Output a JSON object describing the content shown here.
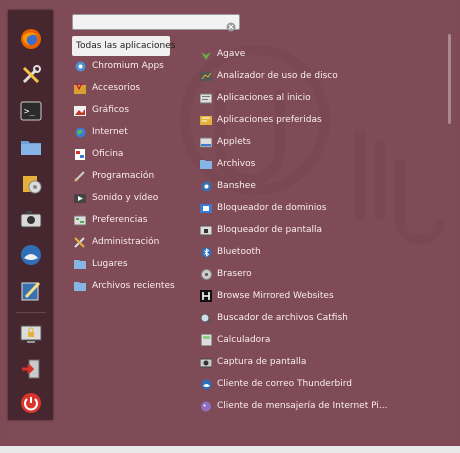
{
  "search": {
    "value": "",
    "placeholder": ""
  },
  "favorites": [
    {
      "icon": "firefox-icon"
    },
    {
      "icon": "settings-tools-icon"
    },
    {
      "icon": "terminal-icon"
    },
    {
      "icon": "folder-icon"
    },
    {
      "icon": "software-package-icon"
    },
    {
      "icon": "camera-icon"
    },
    {
      "icon": "thunderbird-icon"
    },
    {
      "icon": "text-editor-icon"
    },
    {
      "icon": "lock-screen-icon"
    },
    {
      "icon": "logout-icon"
    },
    {
      "icon": "power-icon"
    }
  ],
  "categories": [
    {
      "label": "Todas las aplicaciones",
      "icon": "none",
      "selected": true
    },
    {
      "label": "Chromium Apps",
      "icon": "chromium-icon"
    },
    {
      "label": "Accesorios",
      "icon": "accessories-icon"
    },
    {
      "label": "Gráficos",
      "icon": "graphics-icon"
    },
    {
      "label": "Internet",
      "icon": "internet-icon"
    },
    {
      "label": "Oficina",
      "icon": "office-icon"
    },
    {
      "label": "Programación",
      "icon": "programming-icon"
    },
    {
      "label": "Sonido y vídeo",
      "icon": "sound-video-icon"
    },
    {
      "label": "Preferencias",
      "icon": "preferences-icon"
    },
    {
      "label": "Administración",
      "icon": "administration-icon"
    },
    {
      "label": "Lugares",
      "icon": "places-icon"
    },
    {
      "label": "Archivos recientes",
      "icon": "recent-files-icon"
    }
  ],
  "apps": [
    {
      "label": "Agave",
      "icon": "agave-icon"
    },
    {
      "label": "Analizador de uso de disco",
      "icon": "disk-usage-icon"
    },
    {
      "label": "Aplicaciones al inicio",
      "icon": "startup-apps-icon"
    },
    {
      "label": "Aplicaciones preferidas",
      "icon": "preferred-apps-icon"
    },
    {
      "label": "Applets",
      "icon": "applets-icon"
    },
    {
      "label": "Archivos",
      "icon": "files-icon"
    },
    {
      "label": "Banshee",
      "icon": "banshee-icon"
    },
    {
      "label": "Bloqueador de dominios",
      "icon": "domain-blocker-icon"
    },
    {
      "label": "Bloqueador de pantalla",
      "icon": "screen-locker-icon"
    },
    {
      "label": "Bluetooth",
      "icon": "bluetooth-icon"
    },
    {
      "label": "Brasero",
      "icon": "brasero-icon"
    },
    {
      "label": "Browse Mirrored Websites",
      "icon": "httrack-icon"
    },
    {
      "label": "Buscador de archivos Catfish",
      "icon": "catfish-icon"
    },
    {
      "label": "Calculadora",
      "icon": "calculator-icon"
    },
    {
      "label": "Captura de pantalla",
      "icon": "screenshot-icon"
    },
    {
      "label": "Cliente de correo Thunderbird",
      "icon": "thunderbird-mail-icon"
    },
    {
      "label": "Cliente de mensajería de Internet Pi...",
      "icon": "pidgin-icon"
    }
  ],
  "colors": {
    "favbar": "#3c2128",
    "menu_bg": "#7d4a55",
    "text": "#fbeef0",
    "accent_red": "#c0392b"
  }
}
